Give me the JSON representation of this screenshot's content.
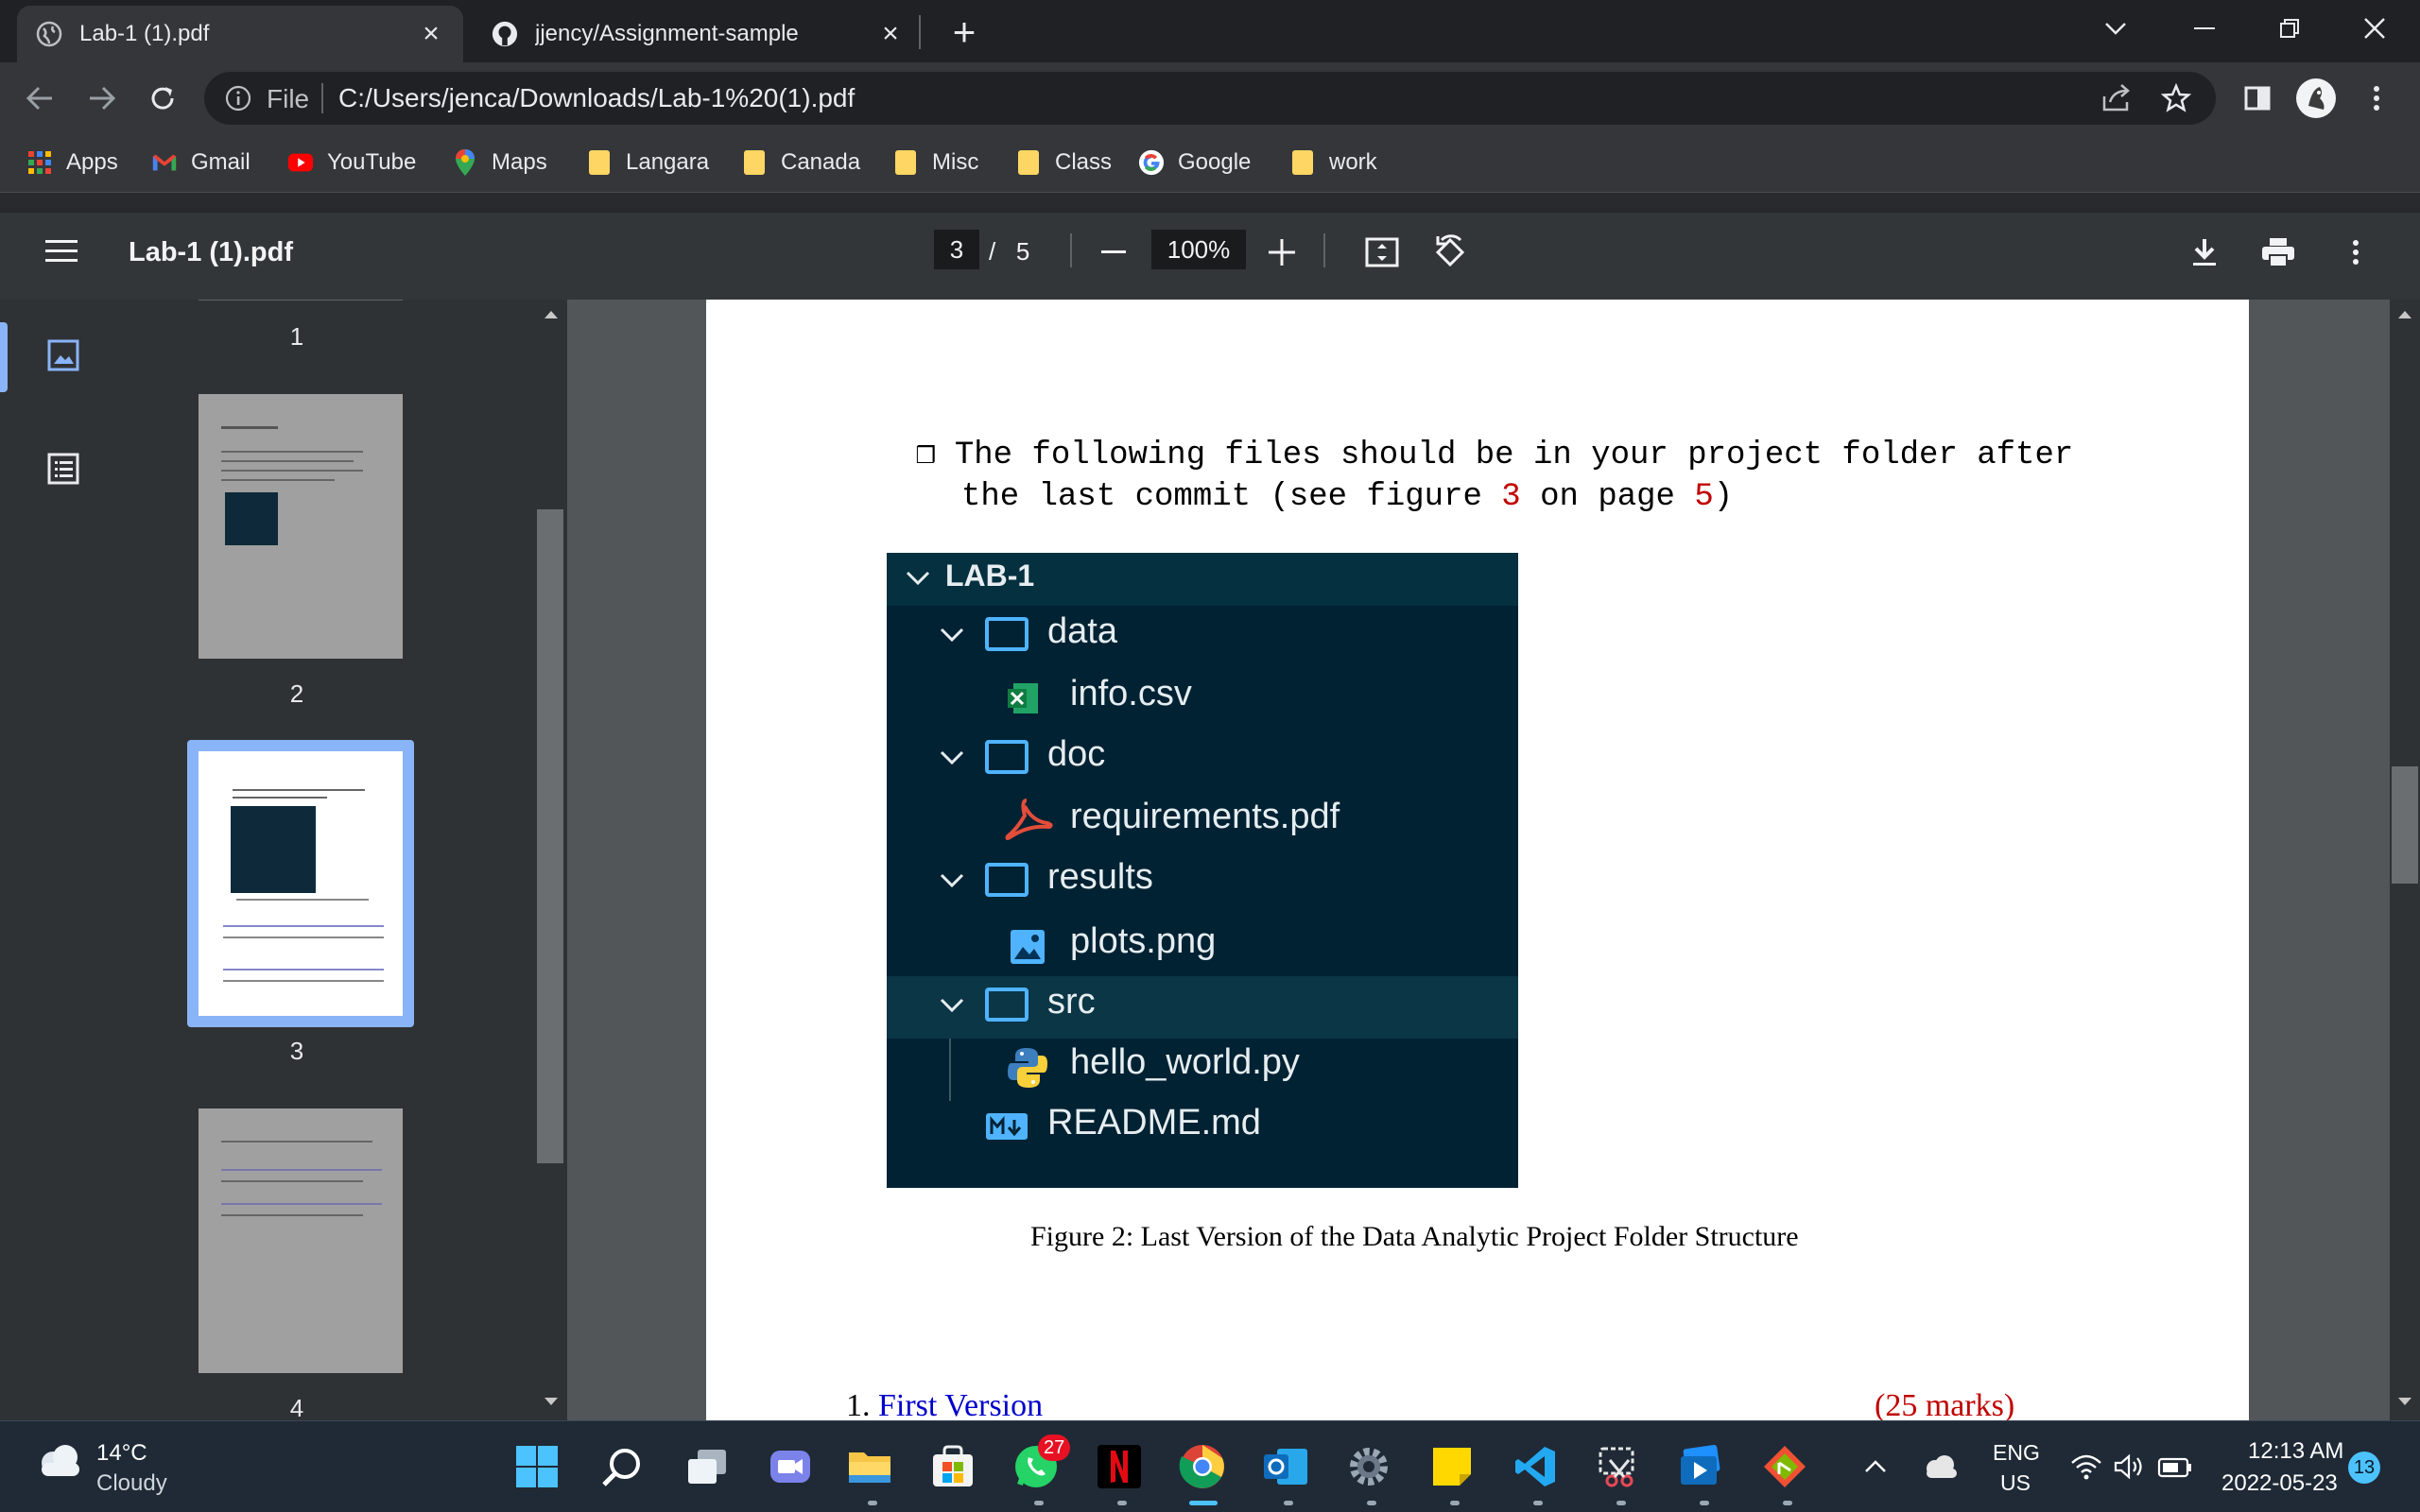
{
  "tabs": [
    {
      "title": "Lab-1 (1).pdf",
      "active": true,
      "icon": "globe-icon"
    },
    {
      "title": "jjency/Assignment-sample",
      "active": false,
      "icon": "github-icon"
    }
  ],
  "toolbar": {
    "scheme": "File",
    "url": "C:/Users/jenca/Downloads/Lab-1%20(1).pdf"
  },
  "bookmarks": [
    {
      "label": "Apps",
      "icon": "apps-grid-icon"
    },
    {
      "label": "Gmail",
      "icon": "gmail-icon"
    },
    {
      "label": "YouTube",
      "icon": "youtube-icon"
    },
    {
      "label": "Maps",
      "icon": "maps-pin-icon"
    },
    {
      "label": "Langara",
      "icon": "folder-icon"
    },
    {
      "label": "Canada",
      "icon": "folder-icon"
    },
    {
      "label": "Misc",
      "icon": "folder-icon"
    },
    {
      "label": "Class",
      "icon": "folder-icon"
    },
    {
      "label": "Google",
      "icon": "google-icon"
    },
    {
      "label": "work",
      "icon": "folder-icon"
    }
  ],
  "pdf": {
    "title": "Lab-1 (1).pdf",
    "current_page": "3",
    "page_sep": "/",
    "total_pages": "5",
    "zoom": "100%"
  },
  "thumbnails": [
    {
      "label": "1"
    },
    {
      "label": "2"
    },
    {
      "label": "3",
      "selected": true
    },
    {
      "label": "4"
    }
  ],
  "document": {
    "bullet_line1": "❒ The following files should be in your project folder after",
    "bullet_line2_pre": "the last commit (see figure ",
    "bullet_fig": "3",
    "bullet_line2_mid": " on page ",
    "bullet_page": "5",
    "bullet_line2_post": ")",
    "explorer": {
      "root": "LAB-1",
      "items": [
        {
          "name": "data",
          "type": "folder"
        },
        {
          "name": "info.csv",
          "type": "csv"
        },
        {
          "name": "doc",
          "type": "folder"
        },
        {
          "name": "requirements.pdf",
          "type": "pdf"
        },
        {
          "name": "results",
          "type": "folder"
        },
        {
          "name": "plots.png",
          "type": "image"
        },
        {
          "name": "src",
          "type": "folder"
        },
        {
          "name": "hello_world.py",
          "type": "python"
        },
        {
          "name": "README.md",
          "type": "markdown"
        }
      ]
    },
    "caption": "Figure 2: Last Version of the Data Analytic Project Folder Structure",
    "section_number": "1.",
    "section_title": "First Version",
    "section_marks": "(25 marks)"
  },
  "taskbar": {
    "weather_temp": "14°C",
    "weather_desc": "Cloudy",
    "whatsapp_badge": "27",
    "lang_line1": "ENG",
    "lang_line2": "US",
    "time": "12:13 AM",
    "date": "2022-05-23",
    "notif_count": "13"
  },
  "colors": {
    "accent": "#8ab4f8",
    "explorer_bg": "#002233",
    "marks_red": "#c00000",
    "section_blue": "#0000cc"
  }
}
